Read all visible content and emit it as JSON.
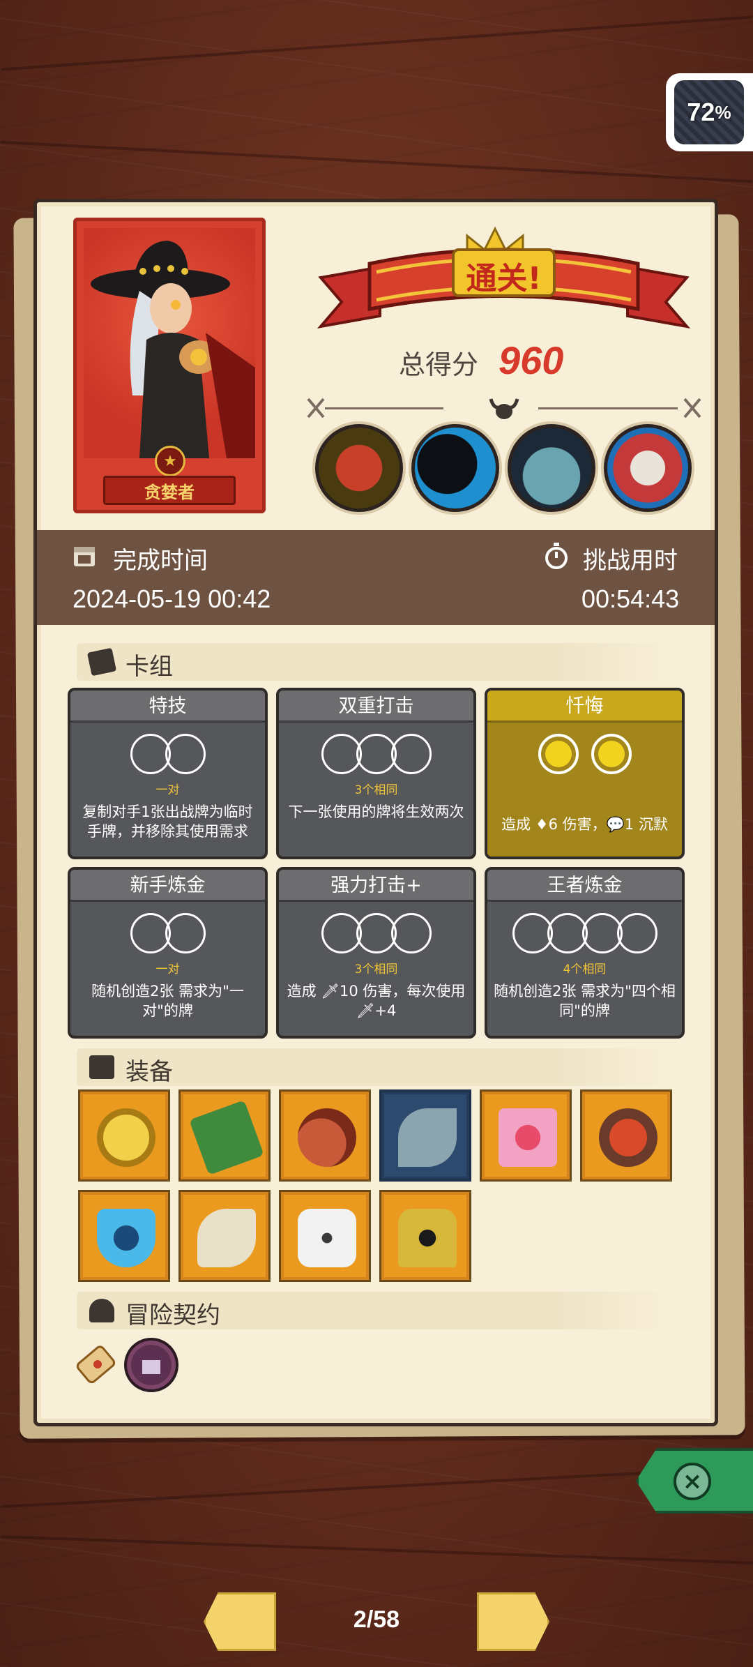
{
  "battery": {
    "percent": "72",
    "unit": "%"
  },
  "portrait": {
    "character_name": "贪婪者"
  },
  "result": {
    "banner_text": "通关!",
    "score_label": "总得分",
    "score_value": "960"
  },
  "bosses": [
    {
      "icon": "boss-one-eyed-mouth-icon",
      "color": "#c8402a"
    },
    {
      "icon": "boss-shadow-dragon-icon",
      "color": "#1e8fcf"
    },
    {
      "icon": "boss-fish-ogre-icon",
      "color": "#4aa0c8"
    },
    {
      "icon": "boss-crowned-skull-icon",
      "color": "#c43a3a"
    }
  ],
  "times": {
    "finish_label": "完成时间",
    "finish_value": "2024-05-19 00:42",
    "challenge_label": "挑战用时",
    "challenge_value": "00:54:43"
  },
  "deck": {
    "title": "卡组",
    "cards": [
      {
        "name": "特技",
        "sub": "一对",
        "desc": "复制对手1张出战牌为临时手牌，并移除其使用需求",
        "circles": 2,
        "style": "gray"
      },
      {
        "name": "双重打击",
        "sub": "3个相同",
        "desc": "下一张使用的牌将生效两次",
        "circles": 3,
        "style": "gray"
      },
      {
        "name": "忏悔",
        "sub": "",
        "desc": "造成 ♦6 伤害，💬1 沉默",
        "circles": 2,
        "style": "gold"
      },
      {
        "name": "新手炼金",
        "sub": "一对",
        "desc": "随机创造2张 需求为\"一对\"的牌",
        "circles": 2,
        "style": "gray"
      },
      {
        "name": "强力打击+",
        "sub": "3个相同",
        "desc": "造成 🗡10 伤害，每次使用🗡+4",
        "circles": 3,
        "style": "gray"
      },
      {
        "name": "王者炼金",
        "sub": "4个相同",
        "desc": "随机创造2张 需求为\"四个相同\"的牌",
        "circles": 4,
        "style": "gray"
      }
    ]
  },
  "equipment": {
    "title": "装备",
    "items": [
      {
        "icon": "gold-coin-icon"
      },
      {
        "icon": "green-book-icon"
      },
      {
        "icon": "meat-leg-icon"
      },
      {
        "icon": "sickle-blade-icon"
      },
      {
        "icon": "heart-chest-icon"
      },
      {
        "icon": "red-gem-plate-icon"
      },
      {
        "icon": "blue-shield-icon"
      },
      {
        "icon": "war-horn-icon"
      },
      {
        "icon": "white-dice-icon"
      },
      {
        "icon": "spiked-helmet-icon"
      }
    ]
  },
  "contract": {
    "title": "冒险契约",
    "items": [
      {
        "icon": "scroll-icon"
      },
      {
        "icon": "fist-badge-icon"
      }
    ]
  },
  "pager": {
    "text": "2/58"
  },
  "colors": {
    "accent_red": "#d73a2a",
    "banner_red": "#c7302a",
    "panel_brown": "#6e5343",
    "paper": "#f8efd8"
  }
}
